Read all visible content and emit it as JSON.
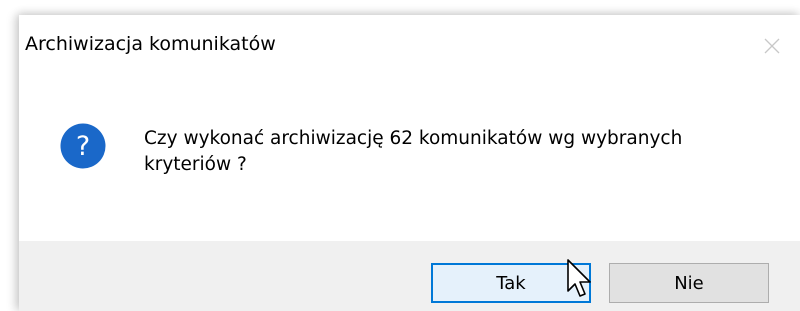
{
  "dialog": {
    "title": "Archiwizacja komunikatów",
    "message_line1": "Czy wykonać archiwizację 62 komunikatów wg wybranych",
    "message_line2": "kryteriów ?",
    "icon": "question-icon",
    "buttons": {
      "yes_label": "Tak",
      "no_label": "Nie"
    }
  },
  "colors": {
    "accent": "#0078d7",
    "icon_blue": "#1a68c9",
    "footer_bg": "#f0f0f0"
  },
  "cursor": "arrow-pointer"
}
